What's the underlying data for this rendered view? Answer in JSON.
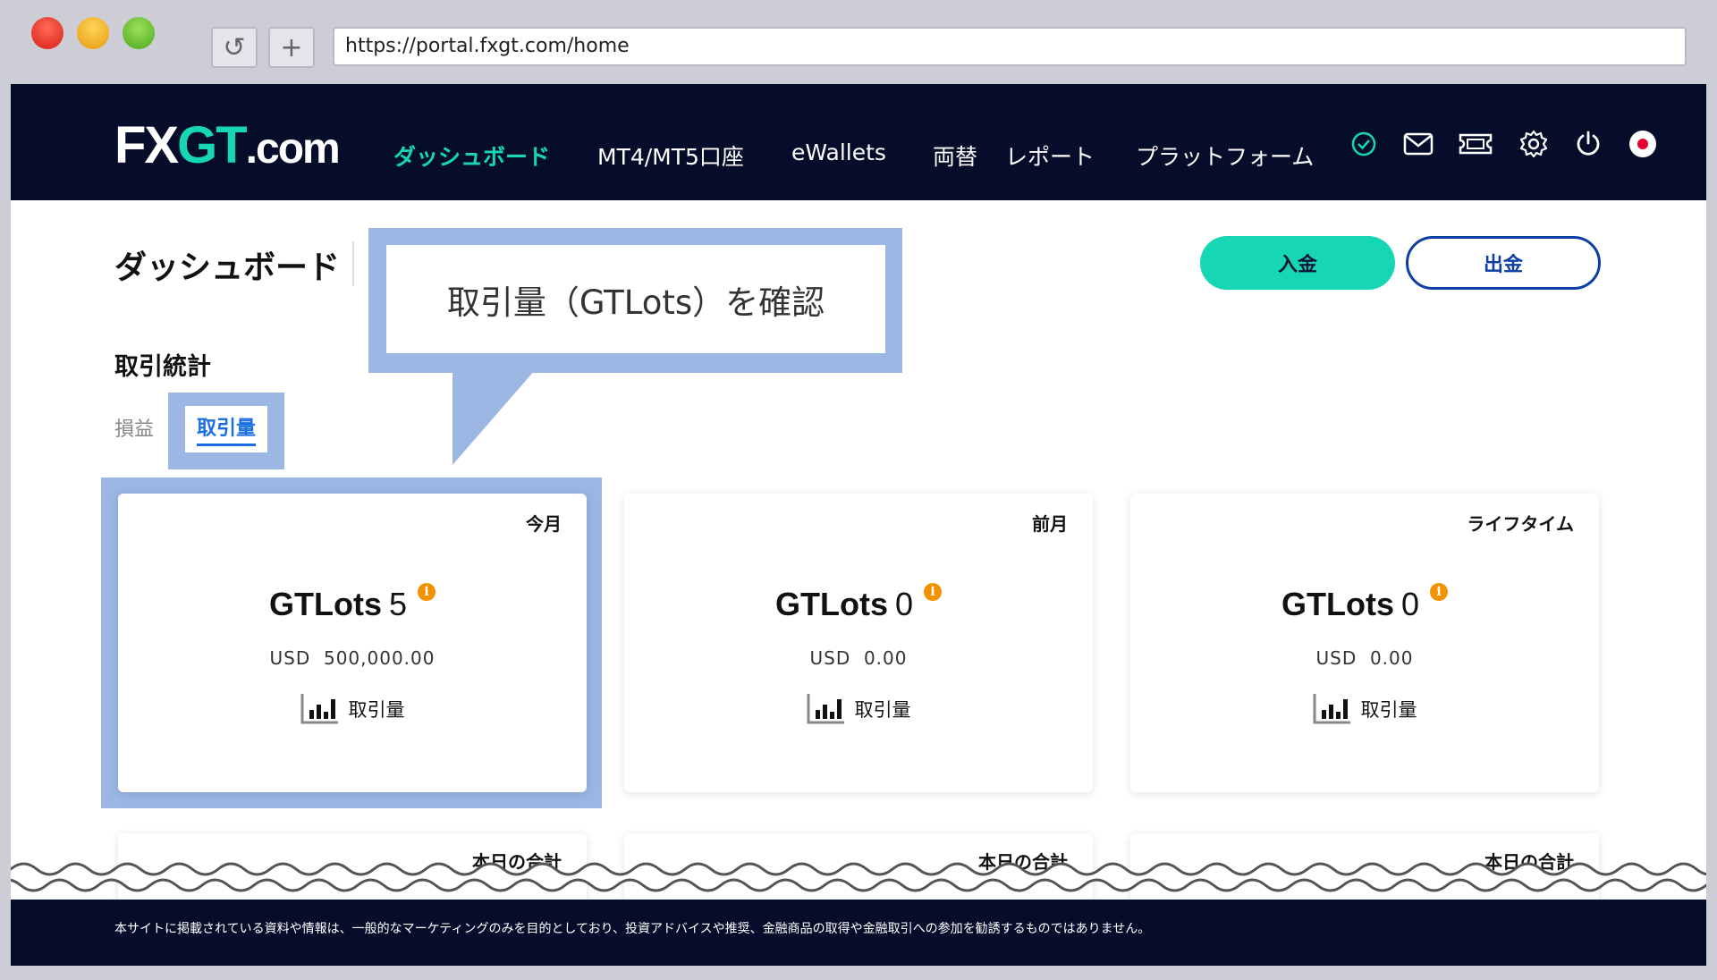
{
  "browser": {
    "url": "https://portal.fxgt.com/home",
    "reload_glyph": "↺",
    "newtab_glyph": "+"
  },
  "logo": {
    "fx": "FX",
    "gt": "GT",
    "dotcom": ".com"
  },
  "nav": {
    "items": [
      "ダッシュボード",
      "MT4/MT5口座",
      "eWallets",
      "両替",
      "レポート",
      "プラットフォーム"
    ],
    "icons": [
      "check-circle-icon",
      "mail-icon",
      "ticket-icon",
      "gear-icon",
      "power-icon",
      "language-flag-icon"
    ]
  },
  "page": {
    "title": "ダッシュボード",
    "deposit_label": "入金",
    "withdraw_label": "出金"
  },
  "callout": {
    "text": "取引量（GTLots）を確認"
  },
  "stats": {
    "section_title": "取引統計",
    "tabs": [
      "損益",
      "取引量"
    ],
    "active_tab": "取引量",
    "cards": [
      {
        "period": "今月",
        "label": "GTLots",
        "lots": "5",
        "usd_label": "USD",
        "usd_value": "500,000.00",
        "volume_label": "取引量"
      },
      {
        "period": "前月",
        "label": "GTLots",
        "lots": "0",
        "usd_label": "USD",
        "usd_value": "0.00",
        "volume_label": "取引量"
      },
      {
        "period": "ライフタイム",
        "label": "GTLots",
        "lots": "0",
        "usd_label": "USD",
        "usd_value": "0.00",
        "volume_label": "取引量"
      }
    ],
    "daily_cards": [
      {
        "period": "本日の合計"
      },
      {
        "period": "本日の合計"
      },
      {
        "period": "本日の合計"
      }
    ],
    "info_glyph": "i"
  },
  "footer": {
    "disclaimer": "本サイトに掲載されている資料や情報は、一般的なマーケティングのみを目的としており、投資アドバイスや推奨、金融商品の取得や金融取引への参加を勧誘するものではありません。"
  },
  "colors": {
    "accent": "#17d6b3",
    "nav_bg": "#060d2a",
    "highlight": "#9bb6e3",
    "withdraw": "#0d3ea3",
    "info": "#f39200"
  }
}
